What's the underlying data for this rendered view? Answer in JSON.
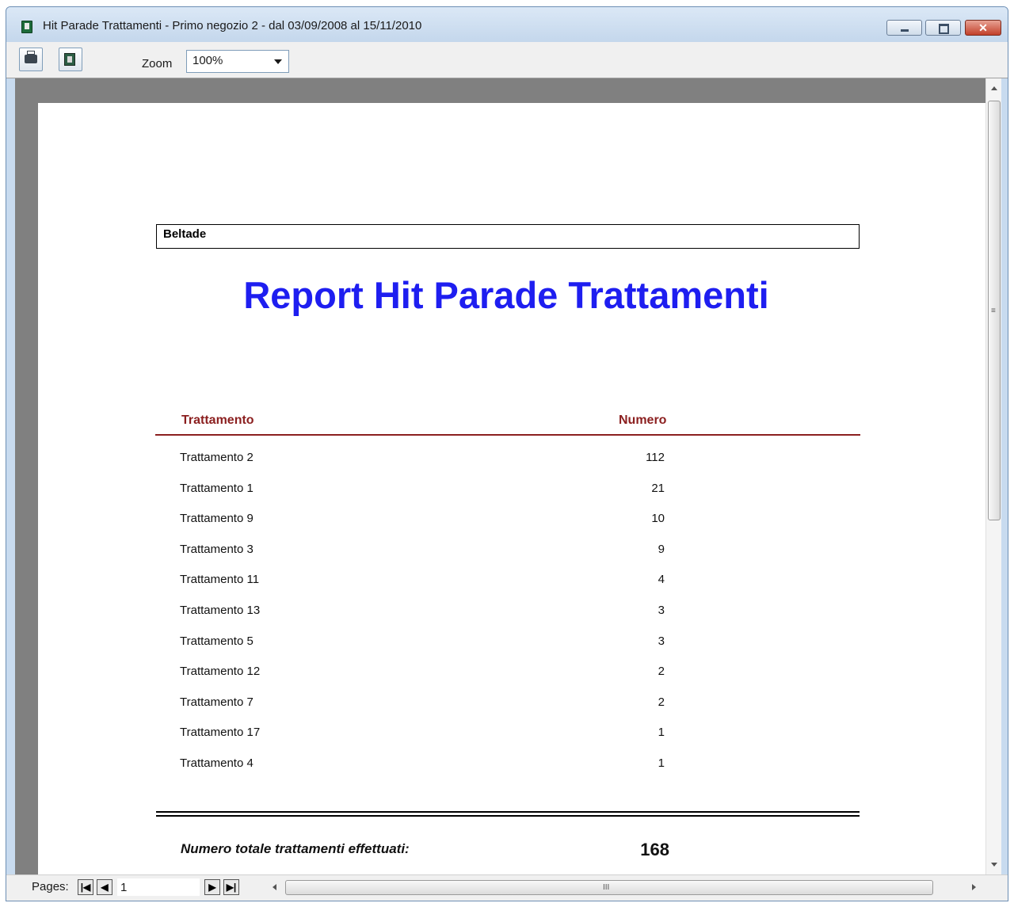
{
  "window": {
    "title": "Hit Parade Trattamenti - Primo negozio 2 - dal 03/09/2008 al 15/11/2010",
    "close_glyph": "✕"
  },
  "toolbar": {
    "print_icon": "printer-icon",
    "export_icon": "export-icon",
    "zoom_label": "Zoom",
    "zoom_value": "100%"
  },
  "report": {
    "company": "Beltade",
    "title": "Report Hit Parade Trattamenti",
    "columns": [
      "Trattamento",
      "Numero"
    ],
    "rows": [
      {
        "name": "Trattamento 2",
        "count": "112"
      },
      {
        "name": "Trattamento 1",
        "count": "21"
      },
      {
        "name": "Trattamento 9",
        "count": "10"
      },
      {
        "name": "Trattamento 3",
        "count": "9"
      },
      {
        "name": "Trattamento 11",
        "count": "4"
      },
      {
        "name": "Trattamento 13",
        "count": "3"
      },
      {
        "name": "Trattamento 5",
        "count": "3"
      },
      {
        "name": "Trattamento 12",
        "count": "2"
      },
      {
        "name": "Trattamento 7",
        "count": "2"
      },
      {
        "name": "Trattamento 17",
        "count": "1"
      },
      {
        "name": "Trattamento 4",
        "count": "1"
      }
    ],
    "total_label": "Numero totale trattamenti effettuati:",
    "total_value": "168"
  },
  "statusbar": {
    "pages_label": "Pages:",
    "current_page": "1",
    "nav_first": "|◀",
    "nav_prev": "◀",
    "nav_next": "▶",
    "nav_last": "▶|",
    "scroll_grip": "III"
  },
  "colors": {
    "title": "#1e1ef0",
    "column_header": "#8b1f1f",
    "preview_background": "#808080"
  }
}
